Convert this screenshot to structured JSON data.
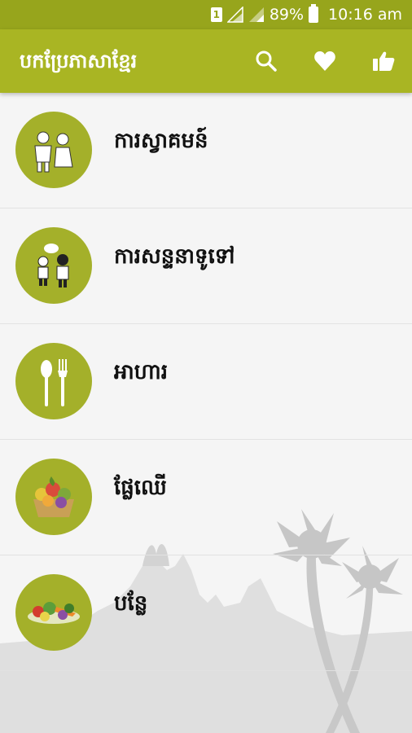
{
  "status_bar": {
    "sim_label": "1",
    "battery": "89%",
    "time": "10:16 am"
  },
  "app_bar": {
    "title": "បកប្រែភាសាខ្មែរ",
    "icons": [
      "search-icon",
      "heart-icon",
      "thumbs-up-icon"
    ]
  },
  "categories": [
    {
      "label": "ការស្វាគមន៍",
      "icon": "greeting-people-icon"
    },
    {
      "label": "ការសន្ទនាទូទៅ",
      "icon": "conversation-icon"
    },
    {
      "label": "អាហារ",
      "icon": "spoon-fork-icon"
    },
    {
      "label": "ផ្លែឈើ",
      "icon": "fruit-basket-icon"
    },
    {
      "label": "បន្លែ",
      "icon": "vegetables-icon"
    }
  ],
  "colors": {
    "status_bar": "#97a51c",
    "app_bar": "#a9b523",
    "icon_circle": "#a4b02a",
    "background": "#f5f5f5"
  }
}
